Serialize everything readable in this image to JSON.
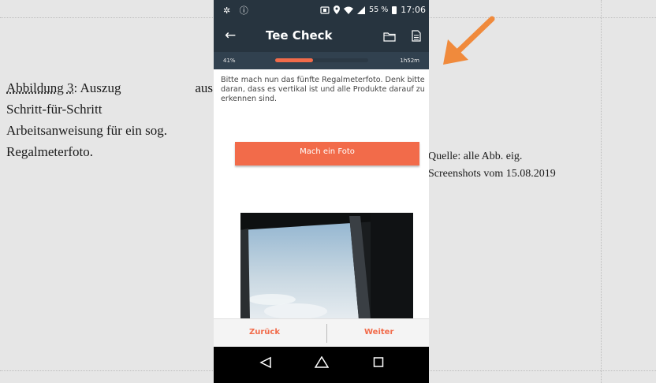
{
  "document": {
    "caption": {
      "label": "Abbildung 3",
      "line1_rest": ": Auszug",
      "line1_end": "aus",
      "line2": "Schritt-für-Schritt",
      "line3": "Arbeitsanweisung für ein sog.",
      "line4": "Regalmeterfoto."
    },
    "source": {
      "line1": "Quelle: alle Abb. eig.",
      "line2": "Screenshots vom 15.08.2019"
    }
  },
  "phone": {
    "status_bar": {
      "left_icons": "✲ ⓘ",
      "battery": "55 %",
      "time": "17:06"
    },
    "app_bar": {
      "back_icon": "←",
      "title": "Tee Check",
      "icons": [
        "folder-icon",
        "document-icon"
      ]
    },
    "progress": {
      "percent_label": "41%",
      "value": 0.41,
      "remaining_time": "1h52m"
    },
    "instruction": "Bitte mach nun das fünfte Regalmeterfoto. Denk bitte daran, dass es vertikal ist und alle Produkte darauf zu erkennen sind.",
    "photo_button": "Mach ein Foto",
    "bottom_nav": {
      "back": "Zurück",
      "next": "Weiter"
    },
    "system_nav": [
      "back-triangle-icon",
      "home-icon",
      "recents-icon"
    ]
  },
  "colors": {
    "accent": "#f26b4a",
    "appbar": "#27343f",
    "progressbar": "#31414f",
    "annotation_arrow": "#f08a3c"
  }
}
